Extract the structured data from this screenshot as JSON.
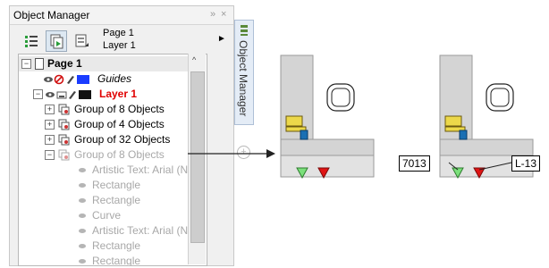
{
  "panel": {
    "title": "Object Manager",
    "controls": [
      "»",
      "×"
    ],
    "page_selector": {
      "line1": "Page 1",
      "line2": "Layer 1",
      "arrow": "►"
    },
    "side_tab": {
      "label": "Object Manager"
    },
    "scroll_up": "^"
  },
  "tree": {
    "items": [
      {
        "label": "Page 1",
        "style": "bold"
      },
      {
        "label": "Guides",
        "style": "italic",
        "color_swatch": "#1a3cff"
      },
      {
        "label": "Layer 1",
        "style": "bold-red",
        "color_swatch": "#111111"
      },
      {
        "label": "Group of 8 Objects"
      },
      {
        "label": "Group of 4 Objects"
      },
      {
        "label": "Group of 32 Objects"
      },
      {
        "label": "Group of 8 Objects",
        "style": "dim"
      },
      {
        "label": "Artistic Text: Arial (Norr",
        "style": "dim"
      },
      {
        "label": "Rectangle",
        "style": "dim"
      },
      {
        "label": "Rectangle",
        "style": "dim"
      },
      {
        "label": "Curve",
        "style": "dim"
      },
      {
        "label": "Artistic Text: Arial (Norr",
        "style": "dim"
      },
      {
        "label": "Rectangle",
        "style": "dim"
      },
      {
        "label": "Rectangle",
        "style": "dim"
      }
    ]
  },
  "drawing": {
    "callout_left": "7013",
    "callout_right": "L-13",
    "colors": {
      "wall": "#d4d4d4",
      "computer": "#ecd84a",
      "triangle_green": "#7be07b",
      "triangle_red": "#e01414",
      "monitor_blue": "#1a6fb3"
    }
  }
}
